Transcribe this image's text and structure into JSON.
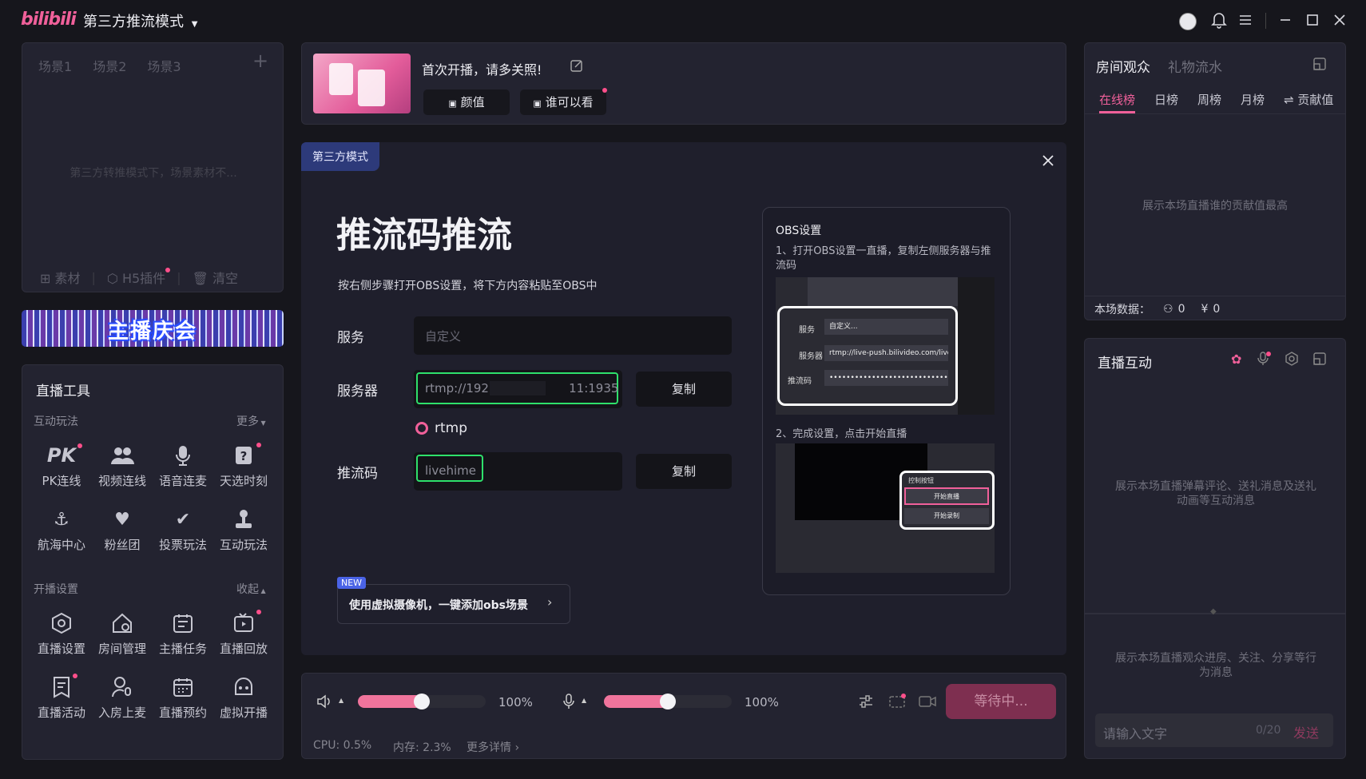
{
  "app": {
    "logo": "bilibili",
    "mode_label": "第三方推流模式"
  },
  "titlebar": {
    "icons": [
      "avatar-icon",
      "bell-icon",
      "menu-icon",
      "minimize-icon",
      "maximize-icon",
      "close-icon"
    ]
  },
  "scenes": {
    "tabs": [
      "场景1",
      "场景2",
      "场景3"
    ],
    "add": "+",
    "empty_text": "第三方转推模式下，场景素材不...",
    "actions": [
      "素材",
      "H5插件",
      "清空"
    ]
  },
  "banner": {
    "text": "主播庆会"
  },
  "tools": {
    "title": "直播工具",
    "interactive_label": "互动玩法",
    "more_label": "更多",
    "interactive_items": [
      "PK连线",
      "视频连线",
      "语音连麦",
      "天选时刻",
      "航海中心",
      "粉丝团",
      "投票玩法",
      "互动玩法"
    ],
    "settings_label": "开播设置",
    "collapse_label": "收起",
    "settings_items": [
      "直播设置",
      "房间管理",
      "主播任务",
      "直播回放",
      "直播活动",
      "入房上麦",
      "直播预约",
      "虚拟开播"
    ]
  },
  "room": {
    "title": "首次开播，请多关照!",
    "tag1": "颜值",
    "tag2": "谁可以看"
  },
  "modal": {
    "badge": "第三方模式",
    "heading": "推流码推流",
    "instruction": "按右侧步骤打开OBS设置，将下方内容粘贴至OBS中",
    "service_label": "服务",
    "service_placeholder": "自定义",
    "server_label": "服务器",
    "server_value": "rtmp://192.                    11:1935",
    "copy_label": "复制",
    "protocol": "rtmp",
    "key_label": "推流码",
    "key_value": "livehime",
    "new_badge": "NEW",
    "virtual_cam": "使用虚拟摄像机，一键添加obs场景"
  },
  "obs_guide": {
    "title": "OBS设置",
    "step1": "1、打开OBS设置一直播，复制左侧服务器与推流码",
    "step1_service": "服务",
    "step1_service_val": "自定义...",
    "step1_server": "服务器",
    "step1_server_val": "rtmp://live-push.bilivideo.com/live-",
    "step1_key": "推流码",
    "step1_key_val": "••••••••••••••••••••••••••••••••••••",
    "step2": "2、完成设置，点击开始直播",
    "controls_title": "控制按钮",
    "start_stream": "开始直播",
    "start_record": "开始录制"
  },
  "bottom": {
    "speaker_pct": "100%",
    "speaker_level": 0.5,
    "mic_pct": "100%",
    "mic_level": 0.5,
    "status_button": "等待中...",
    "cpu": "CPU: 0.5%",
    "mem": "内存: 2.3%",
    "details": "更多详情"
  },
  "audience": {
    "tab_active": "房间观众",
    "tab_other": "礼物流水",
    "subtabs": [
      "在线榜",
      "日榜",
      "周榜",
      "月榜",
      "⇌ 贡献值"
    ],
    "empty_text": "展示本场直播谁的贡献值最高",
    "stats_label": "本场数据：",
    "viewers": "0",
    "income": "0"
  },
  "interaction": {
    "title": "直播互动",
    "empty_text": "展示本场直播弹幕评论、送礼消息及送礼动画等互动消息",
    "empty_text2": "展示本场直播观众进房、关注、分享等行为消息",
    "input_placeholder": "请输入文字",
    "counter": "0/20",
    "send": "发送"
  }
}
